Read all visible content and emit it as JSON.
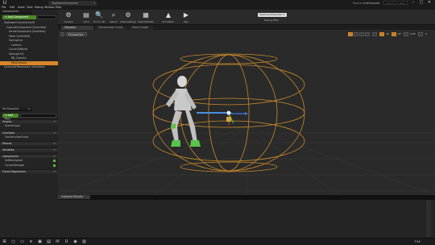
{
  "titlebar": {
    "logo_glyph": "U",
    "doc_tab": "TopDownCharacter",
    "tab_close": "x",
    "source_data": "Source data",
    "project": "Character",
    "search_placeholder": "Search For Help",
    "min": "–",
    "max": "□",
    "close": "✕"
  },
  "menu": [
    "File",
    "Edit",
    "Asset",
    "View",
    "Debug",
    "Window",
    "Help"
  ],
  "components": {
    "tab_label": "Components",
    "add_button": "+ Add Component",
    "tree": [
      {
        "label": "TopDownCharacter(self)",
        "indent": 1
      },
      {
        "label": "CapsuleComponent (Inherited)",
        "indent": 2
      },
      {
        "label": "ArrowComponent (Inherited)",
        "indent": 3
      },
      {
        "label": "Mesh (Inherited)",
        "indent": 3
      },
      {
        "label": "SpringArm",
        "indent": 3
      },
      {
        "label": "Camera",
        "indent": 4
      },
      {
        "label": "CursorToWorld",
        "indent": 3
      },
      {
        "label": "SpringArm1",
        "indent": 3
      },
      {
        "label": "BB_Camera",
        "indent": 4
      },
      {
        "label": "MiniCamera",
        "indent": 4,
        "selected": true
      },
      {
        "label": "CharacterMovement (Inherited)",
        "indent": 1
      }
    ]
  },
  "my_blueprint": {
    "tab_label": "My Blueprint",
    "tab_close": "x",
    "add_new": "+ Add New",
    "categories": [
      {
        "label": "Graphs",
        "items": [
          "EventGraph"
        ]
      },
      {
        "label": "Functions",
        "items": [
          "ConstructionScript"
        ]
      },
      {
        "label": "Macros",
        "items": []
      },
      {
        "label": "Variables",
        "items": []
      },
      {
        "label": "Components",
        "items": [
          "SetMaxSpeed",
          "CursorDamage"
        ]
      },
      {
        "label": "Event Dispatchers",
        "items": []
      }
    ],
    "plus": "+"
  },
  "toolbar": {
    "tools": [
      {
        "label": "Compile",
        "icon": "compile-icon",
        "glyph": "⚙"
      },
      {
        "label": "Save",
        "icon": "save-icon",
        "glyph": "▤"
      },
      {
        "label": "Find in CB",
        "icon": "find-in-cb-icon",
        "glyph": "🔍"
      },
      {
        "label": "Search",
        "icon": "search-icon",
        "glyph": "⌕"
      },
      {
        "label": "Class Settings",
        "icon": "class-settings-icon",
        "glyph": "⚙"
      },
      {
        "label": "Class Defaults",
        "icon": "class-defaults-icon",
        "glyph": "▦"
      },
      {
        "label": "Simulation",
        "icon": "simulation-icon",
        "glyph": "▲"
      },
      {
        "label": "Play",
        "icon": "play-icon",
        "glyph": "▶"
      }
    ],
    "debug_select": "TopDownCharacter ▾",
    "debug_filter": "Debug Filter"
  },
  "editor_tabs": [
    "Viewport",
    "Construction Script",
    "Event Graph"
  ],
  "viewport": {
    "perspective": "Perspective",
    "numbers": [
      "10",
      "10°",
      "0.25",
      "4"
    ]
  },
  "compiler": {
    "tab_label": "Compiler Results"
  },
  "taskbar": {
    "icons": [
      {
        "name": "start-icon",
        "glyph": "⊞"
      },
      {
        "name": "search-icon",
        "glyph": "○"
      },
      {
        "name": "task-view-icon",
        "glyph": "▭"
      },
      {
        "name": "edge-icon",
        "glyph": "e"
      },
      {
        "name": "explorer-icon",
        "glyph": "▣"
      },
      {
        "name": "store-icon",
        "glyph": "▤"
      },
      {
        "name": "mail-icon",
        "glyph": "✉"
      },
      {
        "name": "ue-icon",
        "glyph": "U"
      },
      {
        "name": "chrome-icon",
        "glyph": "◉"
      },
      {
        "name": "photos-icon",
        "glyph": "▥"
      }
    ],
    "clock": "7:54"
  },
  "colors": {
    "accent_green": "#4a8a2a",
    "selection_orange": "#d9862b",
    "capsule_orange": "#c98a2a",
    "arrow_blue": "#4a90e2"
  }
}
